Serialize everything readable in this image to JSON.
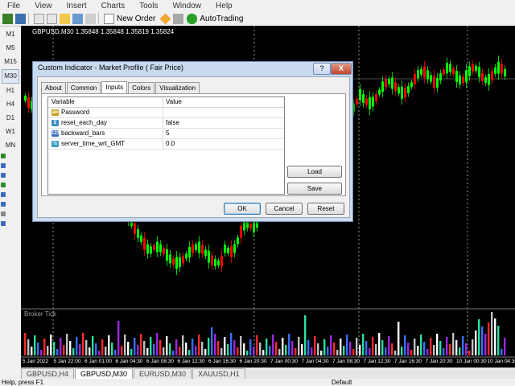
{
  "menu": [
    "File",
    "View",
    "Insert",
    "Charts",
    "Tools",
    "Window",
    "Help"
  ],
  "toolbar": {
    "new_order": "New Order",
    "autotrading": "AutoTrading"
  },
  "timeframes": [
    "M1",
    "M5",
    "M15",
    "M30",
    "H1",
    "H4",
    "D1",
    "W1",
    "MN"
  ],
  "chart": {
    "title": "GBPUSD,M30  1.35848 1.35848 1.35819 1.35824",
    "indicator_label": "Broker Tick",
    "xaxis_labels": [
      "5 Jan 2022",
      "5 Jan 22:00",
      "6 Jan 01:00",
      "6 Jan 04:30",
      "6 Jan 08:30",
      "6 Jan 12:30",
      "6 Jan 16:30",
      "6 Jan 20:30",
      "7 Jan 00:30",
      "7 Jan 04:30",
      "7 Jan 08:30",
      "7 Jan 12:30",
      "7 Jan 16:30",
      "7 Jan 20:30",
      "10 Jan 00:30",
      "10 Jan 04:30"
    ],
    "colors": {
      "bull": "#00ff00",
      "bear": "#ff0000",
      "bg": "#000000",
      "fg": "#ffffff"
    }
  },
  "tabs": [
    "GBPUSD,H4",
    "GBPUSD,M30",
    "EURUSD,M30",
    "XAUUSD,H1"
  ],
  "active_tab": "GBPUSD,M30",
  "status": {
    "left": "Help, press F1",
    "right": "Default"
  },
  "dialog": {
    "title": "Custom Indicator - Market Profile ( Fair Price)",
    "help_label": "?",
    "close_label": "X",
    "tabs": [
      "About",
      "Common",
      "Inputs",
      "Colors",
      "Visualization"
    ],
    "active_tab": "Inputs",
    "columns": [
      "Variable",
      "Value"
    ],
    "rows": [
      {
        "icon": "ab",
        "variable": "Password",
        "value": ""
      },
      {
        "icon": "bool",
        "variable": "reset_each_day",
        "value": "false"
      },
      {
        "icon": "123",
        "variable": "backward_bars",
        "value": "5"
      },
      {
        "icon": "dbl",
        "variable": "server_time_wrt_GMT",
        "value": "0.0"
      }
    ],
    "buttons": {
      "load": "Load",
      "save": "Save",
      "ok": "OK",
      "cancel": "Cancel",
      "reset": "Reset"
    }
  }
}
